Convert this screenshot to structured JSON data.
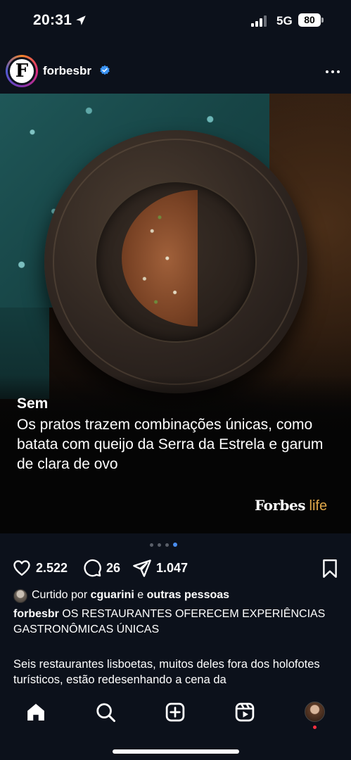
{
  "status_bar": {
    "time": "20:31",
    "network": "5G",
    "battery": "80"
  },
  "post": {
    "username": "forbesbr",
    "avatar_letter": "F",
    "media": {
      "caption_title": "Sem",
      "caption_text": "Os pratos trazem combinações únicas, como batata com queijo da Serra da Estrela e garum de clara de ovo",
      "brand_primary": "Forbes",
      "brand_secondary": "life",
      "carousel_count": 4,
      "carousel_active": 4
    },
    "actions": {
      "likes": "2.522",
      "comments": "26",
      "shares": "1.047"
    },
    "liked_by": {
      "prefix": "Curtido por",
      "user": "cguarini",
      "joiner": "e",
      "others": "outras pessoas"
    },
    "caption": {
      "username": "forbesbr",
      "text": "OS RESTAURANTES OFERECEM EXPERIÊNCIAS GASTRONÔMICAS ÚNICAS"
    },
    "description": "Seis restaurantes lisboetas, muitos deles fora dos holofotes turísticos, estão redesenhando a cena da"
  },
  "nav": {
    "items": [
      "home-icon",
      "search-icon",
      "create-icon",
      "reels-icon",
      "profile-avatar"
    ]
  },
  "colors": {
    "background": "#0c111b",
    "accent": "#4a8ef0",
    "brand_gold": "#e0a84a",
    "notification": "#ff3040"
  }
}
